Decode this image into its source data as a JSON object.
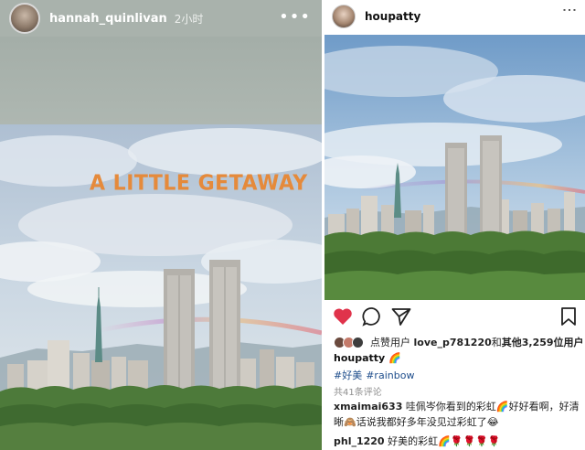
{
  "left": {
    "username": "hannah_quinlivan",
    "time": "2小时",
    "more": "•••",
    "overlay_text": "A LITTLE GETAWAY"
  },
  "right": {
    "username": "houpatty",
    "more": "•••",
    "likes_prefix": "点赞用户 ",
    "likes_user": "love_p781220",
    "likes_mid": "和",
    "likes_others": "其他3,259位用户",
    "caption_user": "houpatty",
    "caption_emoji": "🌈",
    "tags": [
      "#好美",
      "#rainbow"
    ],
    "comment_count": "共41条评论",
    "comments": [
      {
        "user": "xmaimai633",
        "text": " 哇佩岑你看到的彩虹🌈好好看啊，好清晰🙈话说我都好多年没见过彩虹了😂"
      },
      {
        "user": "phl_1220",
        "text": " 好美的彩虹🌈🌹🌹🌹🌹"
      }
    ]
  },
  "colors": {
    "overlay_text": "#e58a3b",
    "tag_link": "#1f4e8c",
    "like_heart": "#e0334b"
  },
  "icons": [
    "heart-icon",
    "comment-icon",
    "share-icon",
    "bookmark-icon",
    "more-icon"
  ]
}
